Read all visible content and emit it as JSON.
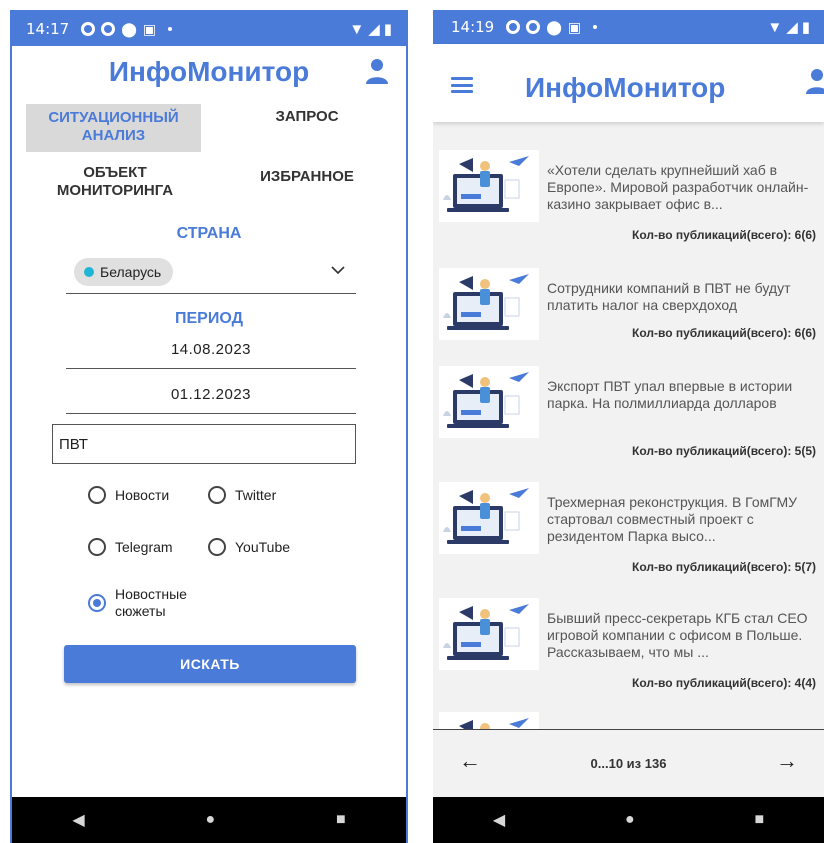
{
  "left": {
    "status": {
      "time": "14:17"
    },
    "app_title": "ИнфоМонитор",
    "tabs": {
      "situation": "СИТУАЦИОННЫЙ АНАЛИЗ",
      "request": "ЗАПРОС",
      "object": "ОБЪЕКТ МОНИТОРИНГА",
      "favorites": "ИЗБРАННОЕ"
    },
    "country_label": "СТРАНА",
    "country_value": "Беларусь",
    "period_label": "ПЕРИОД",
    "date_start": "14.08.2023",
    "date_end": "01.12.2023",
    "query_value": "ПВТ",
    "sources": [
      {
        "label": "Новости",
        "checked": false
      },
      {
        "label": "Twitter",
        "checked": false
      },
      {
        "label": "Telegram",
        "checked": false
      },
      {
        "label": "YouTube",
        "checked": false
      },
      {
        "label": "Новостные сюжеты",
        "checked": true
      }
    ],
    "search_button": "ИСКАТЬ"
  },
  "right": {
    "status": {
      "time": "14:19"
    },
    "app_title": "ИнфоМонитор",
    "results": [
      {
        "title": "«Хотели сделать крупнейший хаб в Европе». Мировой разработчик онлайн-казино закрывает офис в...",
        "count": "Кол-во публикаций(всего): 6(6)"
      },
      {
        "title": "Сотрудники компаний в ПВТ не будут платить налог на сверхдоход",
        "count": "Кол-во публикаций(всего): 6(6)"
      },
      {
        "title": "Экспорт ПВТ упал впервые в истории парка. На полмиллиарда долларов",
        "count": "Кол-во публикаций(всего): 5(5)"
      },
      {
        "title": "Трехмерная реконструкция. В ГомГМУ стартовал совместный проект с резидентом Парка высо...",
        "count": "Кол-во публикаций(всего): 5(7)"
      },
      {
        "title": "Бывший пресс-секретарь КГБ стал CEO игровой компании с офисом в Польше. Рассказываем, что мы ...",
        "count": "Кол-во публикаций(всего): 4(4)"
      }
    ],
    "pager": {
      "text": "0...10 из 136"
    }
  },
  "colors": {
    "accent": "#4a7bd9",
    "chip_dot": "#1fb6d6"
  }
}
